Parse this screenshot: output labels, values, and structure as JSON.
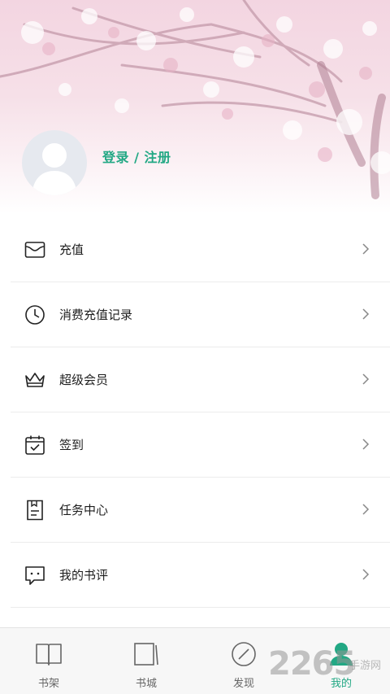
{
  "header": {
    "login_label": "登录 / 注册"
  },
  "menu": {
    "items": [
      {
        "label": "充值",
        "icon": "wallet-icon"
      },
      {
        "label": "消费充值记录",
        "icon": "clock-icon"
      },
      {
        "label": "超级会员",
        "icon": "crown-icon"
      },
      {
        "label": "签到",
        "icon": "calendar-check-icon"
      },
      {
        "label": "任务中心",
        "icon": "task-document-icon"
      },
      {
        "label": "我的书评",
        "icon": "comment-icon"
      }
    ]
  },
  "tabbar": {
    "tabs": [
      {
        "label": "书架",
        "icon": "open-book-icon"
      },
      {
        "label": "书城",
        "icon": "book-icon"
      },
      {
        "label": "发现",
        "icon": "compass-icon"
      },
      {
        "label": "我的",
        "icon": "user-icon",
        "active": true
      }
    ]
  },
  "watermark": {
    "number": "2265",
    "text": "手游网"
  },
  "colors": {
    "accent": "#22a884",
    "header_pink": "#f3d5e1",
    "tabbar_bg": "#f7f7f7"
  }
}
